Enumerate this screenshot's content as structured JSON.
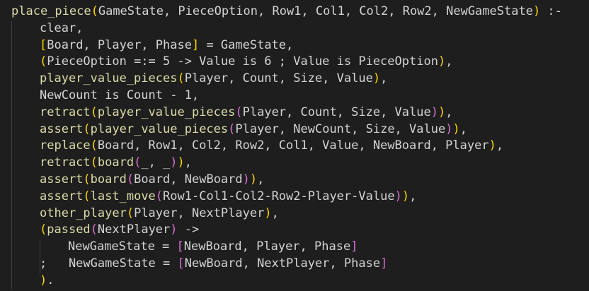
{
  "colors": {
    "background": "#1e1e1e",
    "text": "#d4d4d4",
    "function": "#dcdcaa",
    "bracket_level_1": "#ffd700",
    "bracket_level_2": "#da70d6",
    "bracket_level_3": "#179fff",
    "indent_guide": "#404040"
  },
  "code_lines": [
    {
      "indent": 0,
      "tokens": [
        {
          "t": "place_piece",
          "c": "fn"
        },
        {
          "t": "(",
          "c": "br1"
        },
        {
          "t": "GameState, PieceOption, Row1, Col1, Col2, Row2, NewGameState",
          "c": "text"
        },
        {
          "t": ")",
          "c": "br1"
        },
        {
          "t": " :-",
          "c": "text"
        }
      ]
    },
    {
      "indent": 1,
      "tokens": [
        {
          "t": "clear,",
          "c": "text"
        }
      ]
    },
    {
      "indent": 1,
      "tokens": [
        {
          "t": "[",
          "c": "br1"
        },
        {
          "t": "Board, Player, Phase",
          "c": "text"
        },
        {
          "t": "]",
          "c": "br1"
        },
        {
          "t": " = GameState,",
          "c": "text"
        }
      ]
    },
    {
      "indent": 1,
      "tokens": [
        {
          "t": "(",
          "c": "br1"
        },
        {
          "t": "PieceOption =:= 5 -> Value is 6 ; Value is PieceOption",
          "c": "text"
        },
        {
          "t": ")",
          "c": "br1"
        },
        {
          "t": ",",
          "c": "text"
        }
      ]
    },
    {
      "indent": 1,
      "tokens": [
        {
          "t": "player_value_pieces",
          "c": "fn"
        },
        {
          "t": "(",
          "c": "br1"
        },
        {
          "t": "Player, Count, Size, Value",
          "c": "text"
        },
        {
          "t": ")",
          "c": "br1"
        },
        {
          "t": ",",
          "c": "text"
        }
      ]
    },
    {
      "indent": 1,
      "tokens": [
        {
          "t": "NewCount is Count - 1,",
          "c": "text"
        }
      ]
    },
    {
      "indent": 1,
      "tokens": [
        {
          "t": "retract",
          "c": "fn"
        },
        {
          "t": "(",
          "c": "br1"
        },
        {
          "t": "player_value_pieces",
          "c": "fn"
        },
        {
          "t": "(",
          "c": "br2"
        },
        {
          "t": "Player, Count, Size, Value",
          "c": "text"
        },
        {
          "t": ")",
          "c": "br2"
        },
        {
          "t": ")",
          "c": "br1"
        },
        {
          "t": ",",
          "c": "text"
        }
      ]
    },
    {
      "indent": 1,
      "tokens": [
        {
          "t": "assert",
          "c": "fn"
        },
        {
          "t": "(",
          "c": "br1"
        },
        {
          "t": "player_value_pieces",
          "c": "fn"
        },
        {
          "t": "(",
          "c": "br2"
        },
        {
          "t": "Player, NewCount, Size, Value",
          "c": "text"
        },
        {
          "t": ")",
          "c": "br2"
        },
        {
          "t": ")",
          "c": "br1"
        },
        {
          "t": ",",
          "c": "text"
        }
      ]
    },
    {
      "indent": 1,
      "tokens": [
        {
          "t": "replace",
          "c": "fn"
        },
        {
          "t": "(",
          "c": "br1"
        },
        {
          "t": "Board, Row1, Col2, Row2, Col1, Value, NewBoard, Player",
          "c": "text"
        },
        {
          "t": ")",
          "c": "br1"
        },
        {
          "t": ",",
          "c": "text"
        }
      ]
    },
    {
      "indent": 1,
      "tokens": [
        {
          "t": "retract",
          "c": "fn"
        },
        {
          "t": "(",
          "c": "br1"
        },
        {
          "t": "board",
          "c": "fn"
        },
        {
          "t": "(",
          "c": "br2"
        },
        {
          "t": "_, _",
          "c": "text"
        },
        {
          "t": ")",
          "c": "br2"
        },
        {
          "t": ")",
          "c": "br1"
        },
        {
          "t": ",",
          "c": "text"
        }
      ]
    },
    {
      "indent": 1,
      "tokens": [
        {
          "t": "assert",
          "c": "fn"
        },
        {
          "t": "(",
          "c": "br1"
        },
        {
          "t": "board",
          "c": "fn"
        },
        {
          "t": "(",
          "c": "br2"
        },
        {
          "t": "Board, NewBoard",
          "c": "text"
        },
        {
          "t": ")",
          "c": "br2"
        },
        {
          "t": ")",
          "c": "br1"
        },
        {
          "t": ",",
          "c": "text"
        }
      ]
    },
    {
      "indent": 1,
      "tokens": [
        {
          "t": "assert",
          "c": "fn"
        },
        {
          "t": "(",
          "c": "br1"
        },
        {
          "t": "last_move",
          "c": "fn"
        },
        {
          "t": "(",
          "c": "br2"
        },
        {
          "t": "Row1-Col1-Col2-Row2-Player-Value",
          "c": "text"
        },
        {
          "t": ")",
          "c": "br2"
        },
        {
          "t": ")",
          "c": "br1"
        },
        {
          "t": ",",
          "c": "text"
        }
      ]
    },
    {
      "indent": 1,
      "tokens": [
        {
          "t": "other_player",
          "c": "fn"
        },
        {
          "t": "(",
          "c": "br1"
        },
        {
          "t": "Player, NextPlayer",
          "c": "text"
        },
        {
          "t": ")",
          "c": "br1"
        },
        {
          "t": ",",
          "c": "text"
        }
      ]
    },
    {
      "indent": 1,
      "tokens": [
        {
          "t": "(",
          "c": "br1"
        },
        {
          "t": "passed",
          "c": "fn"
        },
        {
          "t": "(",
          "c": "br2"
        },
        {
          "t": "NextPlayer",
          "c": "text"
        },
        {
          "t": ")",
          "c": "br2"
        },
        {
          "t": " ->",
          "c": "text"
        }
      ]
    },
    {
      "indent": 2,
      "tokens": [
        {
          "t": "NewGameState = ",
          "c": "text"
        },
        {
          "t": "[",
          "c": "br2"
        },
        {
          "t": "NewBoard, Player, Phase",
          "c": "text"
        },
        {
          "t": "]",
          "c": "br2"
        }
      ]
    },
    {
      "indent": 1,
      "tokens": [
        {
          "t": ";   NewGameState = ",
          "c": "text"
        },
        {
          "t": "[",
          "c": "br2"
        },
        {
          "t": "NewBoard, NextPlayer, Phase",
          "c": "text"
        },
        {
          "t": "]",
          "c": "br2"
        }
      ]
    },
    {
      "indent": 1,
      "tokens": [
        {
          "t": ")",
          "c": "br1"
        },
        {
          "t": ".",
          "c": "text"
        }
      ]
    }
  ]
}
